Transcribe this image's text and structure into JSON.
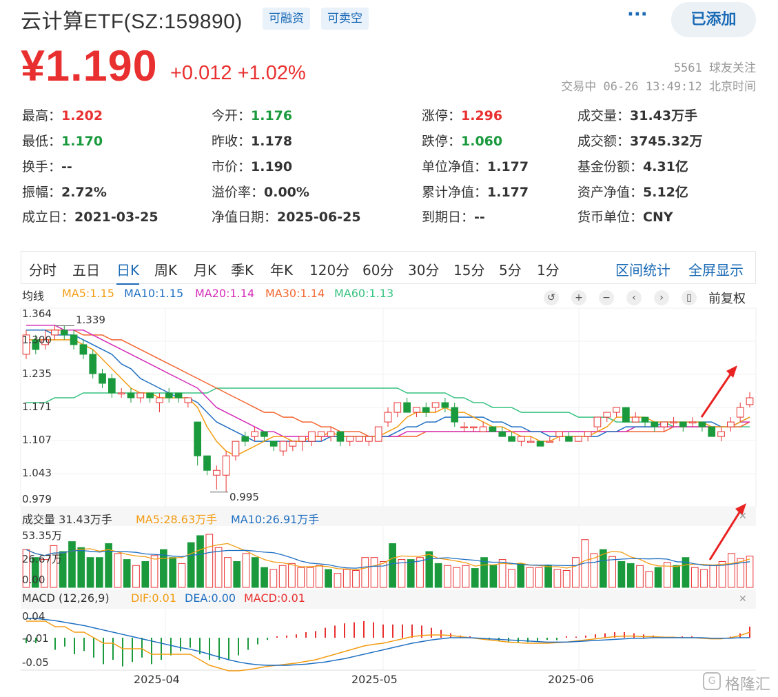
{
  "header": {
    "title": "云计算ETF(SZ:159890)",
    "tags": [
      "可融资",
      "可卖空"
    ],
    "more": "···",
    "add_button": "已添加"
  },
  "quote": {
    "price": "¥1.190",
    "change": "+0.012",
    "change_pct": "+1.02%",
    "followers": "5561 球友关注",
    "status": "交易中 06-26 13:49:12 北京时间"
  },
  "stats": [
    {
      "label": "最高：",
      "value": "1.202",
      "color": "up"
    },
    {
      "label": "今开：",
      "value": "1.176",
      "color": "dn"
    },
    {
      "label": "涨停：",
      "value": "1.296",
      "color": "up"
    },
    {
      "label": "成交量：",
      "value": "31.43万手",
      "color": ""
    },
    {
      "label": "最低：",
      "value": "1.170",
      "color": "dn"
    },
    {
      "label": "昨收：",
      "value": "1.178",
      "color": ""
    },
    {
      "label": "跌停：",
      "value": "1.060",
      "color": "dn"
    },
    {
      "label": "成交额：",
      "value": "3745.32万",
      "color": ""
    },
    {
      "label": "换手：",
      "value": "--",
      "color": ""
    },
    {
      "label": "市价：",
      "value": "1.190",
      "color": ""
    },
    {
      "label": "单位净值：",
      "value": "1.177",
      "color": ""
    },
    {
      "label": "基金份额：",
      "value": "4.31亿",
      "color": ""
    },
    {
      "label": "振幅：",
      "value": "2.72%",
      "color": ""
    },
    {
      "label": "溢价率：",
      "value": "0.00%",
      "color": ""
    },
    {
      "label": "累计净值：",
      "value": "1.177",
      "color": ""
    },
    {
      "label": "资产净值：",
      "value": "5.12亿",
      "color": ""
    },
    {
      "label": "成立日：",
      "value": "2021-03-25",
      "color": ""
    },
    {
      "label": "净值日期：",
      "value": "2025-06-25",
      "color": ""
    },
    {
      "label": "到期日：",
      "value": "--",
      "color": ""
    },
    {
      "label": "货币单位：",
      "value": "CNY",
      "color": ""
    }
  ],
  "tabs": [
    "分时",
    "五日",
    "日K",
    "周K",
    "月K",
    "季K",
    "年K",
    "120分",
    "60分",
    "30分",
    "15分",
    "5分",
    "1分"
  ],
  "active_tab": "日K",
  "tab_links": [
    "区间统计",
    "全屏显示"
  ],
  "ma_legend": {
    "label": "均线",
    "items": [
      {
        "text": "MA5:1.15",
        "color": "#f39c12"
      },
      {
        "text": "MA10:1.15",
        "color": "#1f6fc2"
      },
      {
        "text": "MA20:1.14",
        "color": "#d42cb7"
      },
      {
        "text": "MA30:1.14",
        "color": "#f2652e"
      },
      {
        "text": "MA60:1.13",
        "color": "#35c27f"
      }
    ],
    "adjust": "前复权"
  },
  "price_axis": [
    "1.364",
    "1.300",
    "1.235",
    "1.171",
    "1.107",
    "1.043",
    "0.979"
  ],
  "annotations": {
    "high": "1.339",
    "low": "0.995"
  },
  "volume_legend": {
    "label": "成交量 31.43万手",
    "ma5": "MA5:28.63万手",
    "ma10": "MA10:26.91万手",
    "axis": [
      "53.35万",
      "26.67万",
      "0.00"
    ]
  },
  "macd_legend": {
    "label": "MACD (12,26,9)",
    "dif": "DIF:0.01",
    "dea": "DEA:0.00",
    "macd": "MACD:0.01",
    "axis": [
      "0.04",
      "-0.01",
      "-0.05"
    ]
  },
  "x_axis": [
    "2025-04",
    "2025-05",
    "2025-06"
  ],
  "watermark": "格隆汇",
  "colors": {
    "up": "#e93030",
    "down": "#1a9a3d",
    "accent": "#1a6ab5"
  },
  "chart_data": {
    "type": "candlestick",
    "ylim": [
      0.979,
      1.364
    ],
    "candles": [
      {
        "o": 1.28,
        "c": 1.32,
        "h": 1.33,
        "l": 1.27
      },
      {
        "o": 1.31,
        "c": 1.29,
        "h": 1.32,
        "l": 1.28
      },
      {
        "o": 1.3,
        "c": 1.31,
        "h": 1.33,
        "l": 1.29
      },
      {
        "o": 1.32,
        "c": 1.33,
        "h": 1.339,
        "l": 1.31
      },
      {
        "o": 1.33,
        "c": 1.32,
        "h": 1.34,
        "l": 1.31
      },
      {
        "o": 1.32,
        "c": 1.3,
        "h": 1.33,
        "l": 1.29
      },
      {
        "o": 1.3,
        "c": 1.28,
        "h": 1.31,
        "l": 1.27
      },
      {
        "o": 1.28,
        "c": 1.24,
        "h": 1.29,
        "l": 1.23
      },
      {
        "o": 1.24,
        "c": 1.22,
        "h": 1.25,
        "l": 1.21
      },
      {
        "o": 1.23,
        "c": 1.2,
        "h": 1.24,
        "l": 1.19
      },
      {
        "o": 1.2,
        "c": 1.2,
        "h": 1.21,
        "l": 1.19
      },
      {
        "o": 1.2,
        "c": 1.19,
        "h": 1.21,
        "l": 1.18
      },
      {
        "o": 1.19,
        "c": 1.2,
        "h": 1.2,
        "l": 1.18
      },
      {
        "o": 1.2,
        "c": 1.19,
        "h": 1.2,
        "l": 1.18
      },
      {
        "o": 1.18,
        "c": 1.19,
        "h": 1.2,
        "l": 1.16
      },
      {
        "o": 1.2,
        "c": 1.19,
        "h": 1.21,
        "l": 1.18
      },
      {
        "o": 1.2,
        "c": 1.19,
        "h": 1.2,
        "l": 1.18
      },
      {
        "o": 1.18,
        "c": 1.19,
        "h": 1.19,
        "l": 1.17
      },
      {
        "o": 1.14,
        "c": 1.07,
        "h": 1.14,
        "l": 1.05
      },
      {
        "o": 1.07,
        "c": 1.04,
        "h": 1.07,
        "l": 1.03
      },
      {
        "o": 1.03,
        "c": 1.04,
        "h": 1.05,
        "l": 1.0
      },
      {
        "o": 1.03,
        "c": 1.07,
        "h": 1.08,
        "l": 0.995
      },
      {
        "o": 1.07,
        "c": 1.1,
        "h": 1.1,
        "l": 1.06
      },
      {
        "o": 1.11,
        "c": 1.1,
        "h": 1.12,
        "l": 1.09
      },
      {
        "o": 1.11,
        "c": 1.12,
        "h": 1.13,
        "l": 1.1
      },
      {
        "o": 1.12,
        "c": 1.11,
        "h": 1.12,
        "l": 1.1
      },
      {
        "o": 1.1,
        "c": 1.09,
        "h": 1.1,
        "l": 1.08
      },
      {
        "o": 1.08,
        "c": 1.1,
        "h": 1.1,
        "l": 1.07
      },
      {
        "o": 1.09,
        "c": 1.1,
        "h": 1.1,
        "l": 1.08
      },
      {
        "o": 1.1,
        "c": 1.11,
        "h": 1.11,
        "l": 1.08
      },
      {
        "o": 1.1,
        "c": 1.12,
        "h": 1.12,
        "l": 1.09
      },
      {
        "o": 1.11,
        "c": 1.12,
        "h": 1.12,
        "l": 1.1
      },
      {
        "o": 1.11,
        "c": 1.12,
        "h": 1.13,
        "l": 1.1
      },
      {
        "o": 1.12,
        "c": 1.1,
        "h": 1.12,
        "l": 1.09
      },
      {
        "o": 1.1,
        "c": 1.11,
        "h": 1.11,
        "l": 1.09
      },
      {
        "o": 1.1,
        "c": 1.11,
        "h": 1.11,
        "l": 1.1
      },
      {
        "o": 1.1,
        "c": 1.11,
        "h": 1.11,
        "l": 1.09
      },
      {
        "o": 1.1,
        "c": 1.13,
        "h": 1.13,
        "l": 1.1
      },
      {
        "o": 1.14,
        "c": 1.16,
        "h": 1.17,
        "l": 1.13
      },
      {
        "o": 1.16,
        "c": 1.18,
        "h": 1.18,
        "l": 1.15
      },
      {
        "o": 1.18,
        "c": 1.16,
        "h": 1.19,
        "l": 1.16
      },
      {
        "o": 1.16,
        "c": 1.17,
        "h": 1.17,
        "l": 1.15
      },
      {
        "o": 1.17,
        "c": 1.16,
        "h": 1.18,
        "l": 1.15
      },
      {
        "o": 1.17,
        "c": 1.18,
        "h": 1.18,
        "l": 1.16
      },
      {
        "o": 1.18,
        "c": 1.17,
        "h": 1.19,
        "l": 1.16
      },
      {
        "o": 1.17,
        "c": 1.14,
        "h": 1.18,
        "l": 1.13
      },
      {
        "o": 1.13,
        "c": 1.13,
        "h": 1.14,
        "l": 1.12
      },
      {
        "o": 1.13,
        "c": 1.13,
        "h": 1.13,
        "l": 1.12
      },
      {
        "o": 1.12,
        "c": 1.13,
        "h": 1.14,
        "l": 1.12
      },
      {
        "o": 1.13,
        "c": 1.12,
        "h": 1.13,
        "l": 1.12
      },
      {
        "o": 1.12,
        "c": 1.11,
        "h": 1.13,
        "l": 1.11
      },
      {
        "o": 1.11,
        "c": 1.1,
        "h": 1.12,
        "l": 1.1
      },
      {
        "o": 1.1,
        "c": 1.11,
        "h": 1.11,
        "l": 1.09
      },
      {
        "o": 1.1,
        "c": 1.1,
        "h": 1.11,
        "l": 1.1
      },
      {
        "o": 1.1,
        "c": 1.09,
        "h": 1.1,
        "l": 1.09
      },
      {
        "o": 1.1,
        "c": 1.1,
        "h": 1.11,
        "l": 1.1
      },
      {
        "o": 1.11,
        "c": 1.12,
        "h": 1.12,
        "l": 1.1
      },
      {
        "o": 1.11,
        "c": 1.1,
        "h": 1.12,
        "l": 1.1
      },
      {
        "o": 1.1,
        "c": 1.11,
        "h": 1.11,
        "l": 1.1
      },
      {
        "o": 1.11,
        "c": 1.12,
        "h": 1.12,
        "l": 1.1
      },
      {
        "o": 1.13,
        "c": 1.15,
        "h": 1.15,
        "l": 1.12
      },
      {
        "o": 1.15,
        "c": 1.16,
        "h": 1.16,
        "l": 1.14
      },
      {
        "o": 1.16,
        "c": 1.17,
        "h": 1.17,
        "l": 1.15
      },
      {
        "o": 1.17,
        "c": 1.14,
        "h": 1.17,
        "l": 1.14
      },
      {
        "o": 1.14,
        "c": 1.15,
        "h": 1.16,
        "l": 1.14
      },
      {
        "o": 1.15,
        "c": 1.14,
        "h": 1.15,
        "l": 1.13
      },
      {
        "o": 1.14,
        "c": 1.13,
        "h": 1.14,
        "l": 1.12
      },
      {
        "o": 1.13,
        "c": 1.14,
        "h": 1.14,
        "l": 1.12
      },
      {
        "o": 1.14,
        "c": 1.14,
        "h": 1.15,
        "l": 1.13
      },
      {
        "o": 1.14,
        "c": 1.13,
        "h": 1.14,
        "l": 1.12
      },
      {
        "o": 1.14,
        "c": 1.14,
        "h": 1.15,
        "l": 1.13
      },
      {
        "o": 1.14,
        "c": 1.13,
        "h": 1.14,
        "l": 1.12
      },
      {
        "o": 1.13,
        "c": 1.11,
        "h": 1.13,
        "l": 1.11
      },
      {
        "o": 1.11,
        "c": 1.12,
        "h": 1.13,
        "l": 1.1
      },
      {
        "o": 1.13,
        "c": 1.14,
        "h": 1.15,
        "l": 1.12
      },
      {
        "o": 1.15,
        "c": 1.17,
        "h": 1.18,
        "l": 1.14
      },
      {
        "o": 1.176,
        "c": 1.19,
        "h": 1.202,
        "l": 1.17
      }
    ],
    "ma5": [
      1.31,
      1.31,
      1.31,
      1.31,
      1.31,
      1.31,
      1.3,
      1.29,
      1.27,
      1.25,
      1.23,
      1.21,
      1.2,
      1.2,
      1.19,
      1.19,
      1.19,
      1.19,
      1.17,
      1.13,
      1.1,
      1.08,
      1.07,
      1.08,
      1.09,
      1.1,
      1.11,
      1.11,
      1.1,
      1.1,
      1.11,
      1.11,
      1.12,
      1.11,
      1.11,
      1.11,
      1.11,
      1.11,
      1.12,
      1.13,
      1.15,
      1.16,
      1.16,
      1.16,
      1.17,
      1.16,
      1.16,
      1.15,
      1.14,
      1.13,
      1.13,
      1.12,
      1.11,
      1.11,
      1.1,
      1.1,
      1.11,
      1.11,
      1.11,
      1.11,
      1.12,
      1.13,
      1.15,
      1.15,
      1.15,
      1.15,
      1.14,
      1.14,
      1.14,
      1.14,
      1.14,
      1.14,
      1.13,
      1.13,
      1.13,
      1.14,
      1.15
    ],
    "ma10": [
      1.33,
      1.33,
      1.33,
      1.32,
      1.32,
      1.32,
      1.31,
      1.3,
      1.29,
      1.28,
      1.26,
      1.25,
      1.23,
      1.22,
      1.21,
      1.2,
      1.19,
      1.19,
      1.18,
      1.16,
      1.14,
      1.13,
      1.12,
      1.11,
      1.1,
      1.1,
      1.1,
      1.1,
      1.1,
      1.1,
      1.1,
      1.1,
      1.11,
      1.11,
      1.11,
      1.11,
      1.11,
      1.11,
      1.11,
      1.12,
      1.13,
      1.13,
      1.14,
      1.14,
      1.15,
      1.15,
      1.15,
      1.15,
      1.15,
      1.14,
      1.14,
      1.13,
      1.13,
      1.12,
      1.12,
      1.11,
      1.11,
      1.11,
      1.11,
      1.11,
      1.11,
      1.12,
      1.12,
      1.13,
      1.13,
      1.13,
      1.13,
      1.14,
      1.14,
      1.14,
      1.14,
      1.14,
      1.14,
      1.13,
      1.13,
      1.14,
      1.15
    ],
    "ma20": [
      1.34,
      1.34,
      1.34,
      1.34,
      1.33,
      1.33,
      1.33,
      1.32,
      1.31,
      1.3,
      1.29,
      1.28,
      1.27,
      1.26,
      1.25,
      1.24,
      1.23,
      1.22,
      1.21,
      1.19,
      1.17,
      1.16,
      1.15,
      1.14,
      1.13,
      1.12,
      1.12,
      1.11,
      1.11,
      1.11,
      1.11,
      1.11,
      1.11,
      1.11,
      1.11,
      1.11,
      1.11,
      1.11,
      1.11,
      1.11,
      1.12,
      1.12,
      1.12,
      1.12,
      1.12,
      1.12,
      1.12,
      1.12,
      1.12,
      1.12,
      1.12,
      1.12,
      1.12,
      1.12,
      1.12,
      1.12,
      1.12,
      1.12,
      1.12,
      1.12,
      1.12,
      1.12,
      1.12,
      1.12,
      1.13,
      1.13,
      1.13,
      1.13,
      1.13,
      1.13,
      1.13,
      1.13,
      1.13,
      1.13,
      1.13,
      1.14,
      1.14
    ],
    "ma30": [
      1.33,
      1.33,
      1.33,
      1.33,
      1.33,
      1.33,
      1.32,
      1.32,
      1.32,
      1.31,
      1.31,
      1.3,
      1.29,
      1.28,
      1.27,
      1.26,
      1.25,
      1.24,
      1.23,
      1.22,
      1.21,
      1.2,
      1.19,
      1.18,
      1.17,
      1.16,
      1.16,
      1.15,
      1.15,
      1.14,
      1.14,
      1.13,
      1.13,
      1.12,
      1.12,
      1.12,
      1.11,
      1.11,
      1.11,
      1.11,
      1.11,
      1.11,
      1.12,
      1.12,
      1.12,
      1.12,
      1.12,
      1.12,
      1.12,
      1.12,
      1.12,
      1.12,
      1.12,
      1.12,
      1.12,
      1.12,
      1.12,
      1.12,
      1.12,
      1.12,
      1.12,
      1.12,
      1.12,
      1.12,
      1.12,
      1.12,
      1.12,
      1.12,
      1.13,
      1.13,
      1.13,
      1.13,
      1.13,
      1.13,
      1.13,
      1.13,
      1.14
    ],
    "ma60": [
      1.18,
      1.18,
      1.18,
      1.19,
      1.19,
      1.19,
      1.2,
      1.2,
      1.2,
      1.2,
      1.2,
      1.2,
      1.2,
      1.2,
      1.2,
      1.2,
      1.2,
      1.2,
      1.2,
      1.2,
      1.21,
      1.21,
      1.21,
      1.21,
      1.21,
      1.21,
      1.21,
      1.21,
      1.21,
      1.21,
      1.21,
      1.21,
      1.21,
      1.21,
      1.21,
      1.21,
      1.21,
      1.21,
      1.21,
      1.21,
      1.2,
      1.2,
      1.2,
      1.2,
      1.2,
      1.19,
      1.19,
      1.18,
      1.18,
      1.17,
      1.17,
      1.17,
      1.16,
      1.16,
      1.16,
      1.16,
      1.16,
      1.16,
      1.15,
      1.15,
      1.15,
      1.15,
      1.14,
      1.14,
      1.14,
      1.14,
      1.14,
      1.14,
      1.13,
      1.13,
      1.13,
      1.13,
      1.13,
      1.13,
      1.13,
      1.13,
      1.13
    ],
    "volume": [
      38,
      30,
      28,
      42,
      36,
      46,
      40,
      30,
      30,
      44,
      34,
      28,
      22,
      26,
      32,
      38,
      30,
      24,
      45,
      52,
      53.35,
      40,
      30,
      26,
      34,
      30,
      20,
      18,
      22,
      24,
      20,
      20,
      22,
      18,
      14,
      18,
      17,
      30,
      30,
      26,
      44,
      28,
      28,
      30,
      36,
      24,
      22,
      20,
      22,
      19,
      30,
      22,
      28,
      18,
      24,
      20,
      20,
      22,
      18,
      17,
      30,
      48,
      34,
      38,
      31,
      26,
      24,
      22,
      16,
      20,
      25,
      22,
      30,
      20,
      18,
      22,
      26,
      34,
      29,
      31.43
    ],
    "macd_dif": [
      0.03,
      0.03,
      0.03,
      0.02,
      0.02,
      0.01,
      0.01,
      0.0,
      -0.01,
      -0.01,
      -0.02,
      -0.02,
      -0.02,
      -0.03,
      -0.03,
      -0.03,
      -0.03,
      -0.03,
      -0.04,
      -0.05,
      -0.055,
      -0.06,
      -0.06,
      -0.058,
      -0.055,
      -0.052,
      -0.05,
      -0.048,
      -0.046,
      -0.043,
      -0.04,
      -0.035,
      -0.03,
      -0.025,
      -0.02,
      -0.015,
      -0.012,
      -0.01,
      -0.006,
      -0.002,
      0.002,
      0.004,
      0.005,
      0.005,
      0.004,
      0.002,
      0.0,
      -0.002,
      -0.004,
      -0.006,
      -0.008,
      -0.009,
      -0.01,
      -0.01,
      -0.01,
      -0.009,
      -0.008,
      -0.006,
      -0.004,
      -0.002,
      0.0,
      0.002,
      0.003,
      0.003,
      0.002,
      0.002,
      0.001,
      0.001,
      0.0,
      0.0,
      -0.001,
      -0.002,
      -0.002,
      0.0,
      0.004,
      0.01
    ],
    "macd_dea": [
      0.035,
      0.035,
      0.033,
      0.031,
      0.028,
      0.025,
      0.022,
      0.018,
      0.014,
      0.01,
      0.006,
      0.002,
      -0.002,
      -0.006,
      -0.01,
      -0.014,
      -0.018,
      -0.021,
      -0.025,
      -0.03,
      -0.035,
      -0.04,
      -0.044,
      -0.047,
      -0.049,
      -0.05,
      -0.05,
      -0.05,
      -0.049,
      -0.048,
      -0.046,
      -0.044,
      -0.041,
      -0.038,
      -0.034,
      -0.03,
      -0.026,
      -0.022,
      -0.018,
      -0.014,
      -0.01,
      -0.007,
      -0.004,
      -0.002,
      0.0,
      0.0,
      0.0,
      -0.001,
      -0.002,
      -0.003,
      -0.004,
      -0.005,
      -0.006,
      -0.007,
      -0.008,
      -0.008,
      -0.008,
      -0.007,
      -0.006,
      -0.005,
      -0.004,
      -0.003,
      -0.002,
      -0.001,
      -0.001,
      0.0,
      0.0,
      0.0,
      0.0,
      0.0,
      0.0,
      -0.001,
      -0.001,
      -0.001,
      0.0,
      0.0
    ]
  }
}
